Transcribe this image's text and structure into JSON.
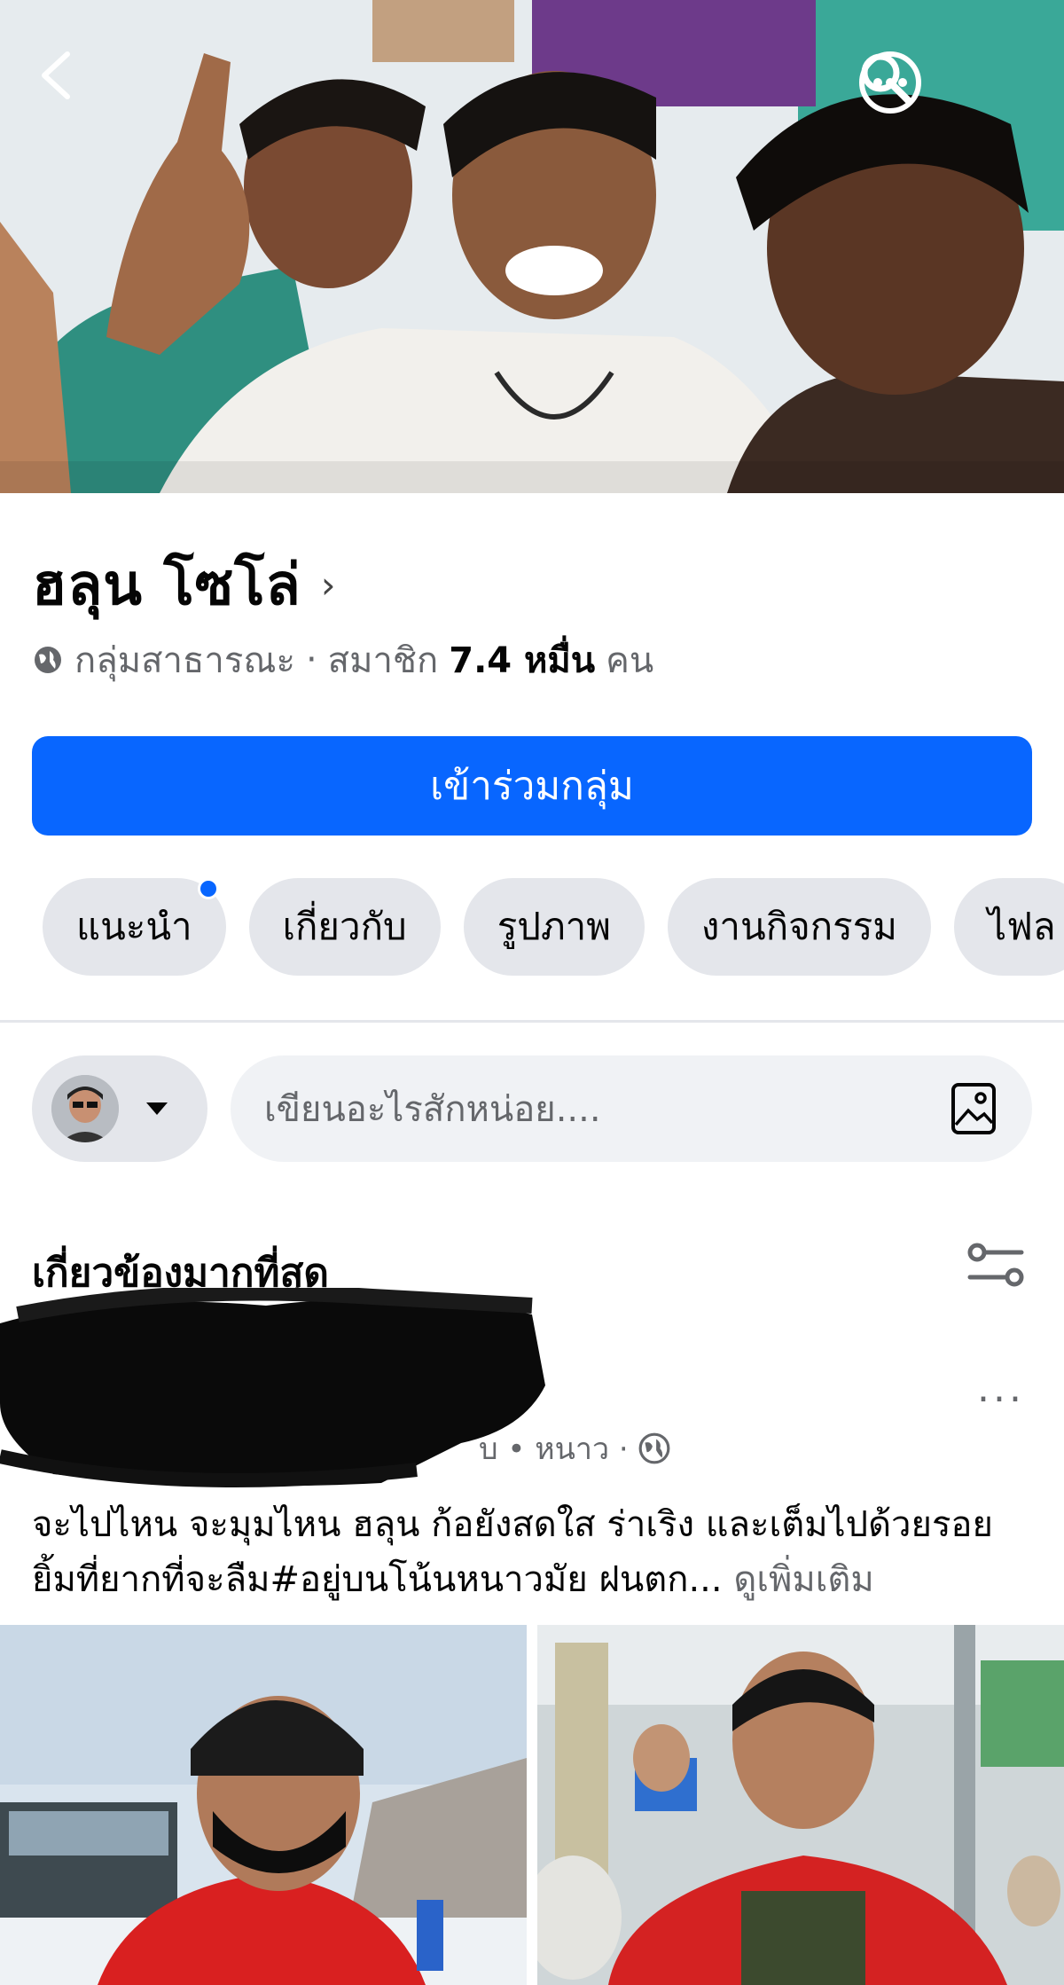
{
  "group": {
    "name": "ฮลุน โซโล่",
    "privacy": "กลุ่มสาธารณะ",
    "separator": "·",
    "members_label": "สมาชิก",
    "members_count": "7.4 หมื่น",
    "members_unit": "คน",
    "join_label": "เข้าร่วมกลุ่ม"
  },
  "tabs": [
    {
      "label": "แนะนำ",
      "has_dot": true
    },
    {
      "label": "เกี่ยวกับ"
    },
    {
      "label": "รูปภาพ"
    },
    {
      "label": "งานกิจกรรม"
    },
    {
      "label": "ไฟล"
    }
  ],
  "composer": {
    "placeholder": "เขียนอะไรสักหน่อย...."
  },
  "feed": {
    "section_title": "เกี่ยวข้องมากที่สุด"
  },
  "post": {
    "meta": "บ • หนาว ·",
    "text": "จะไปไหน จะมุมไหน ฮลุน ก้อยังสดใส ร่าเริง และเต็มไปด้วยรอยยิ้มที่ยากที่จะลืม#อยู่บนโน้นหนาวมัย ฝนตก...",
    "see_more": "ดูเพิ่มเติม",
    "more_icon": "..."
  },
  "colors": {
    "accent": "#0866ff",
    "chip_bg": "#e4e6eb",
    "muted_text": "#65676b"
  }
}
